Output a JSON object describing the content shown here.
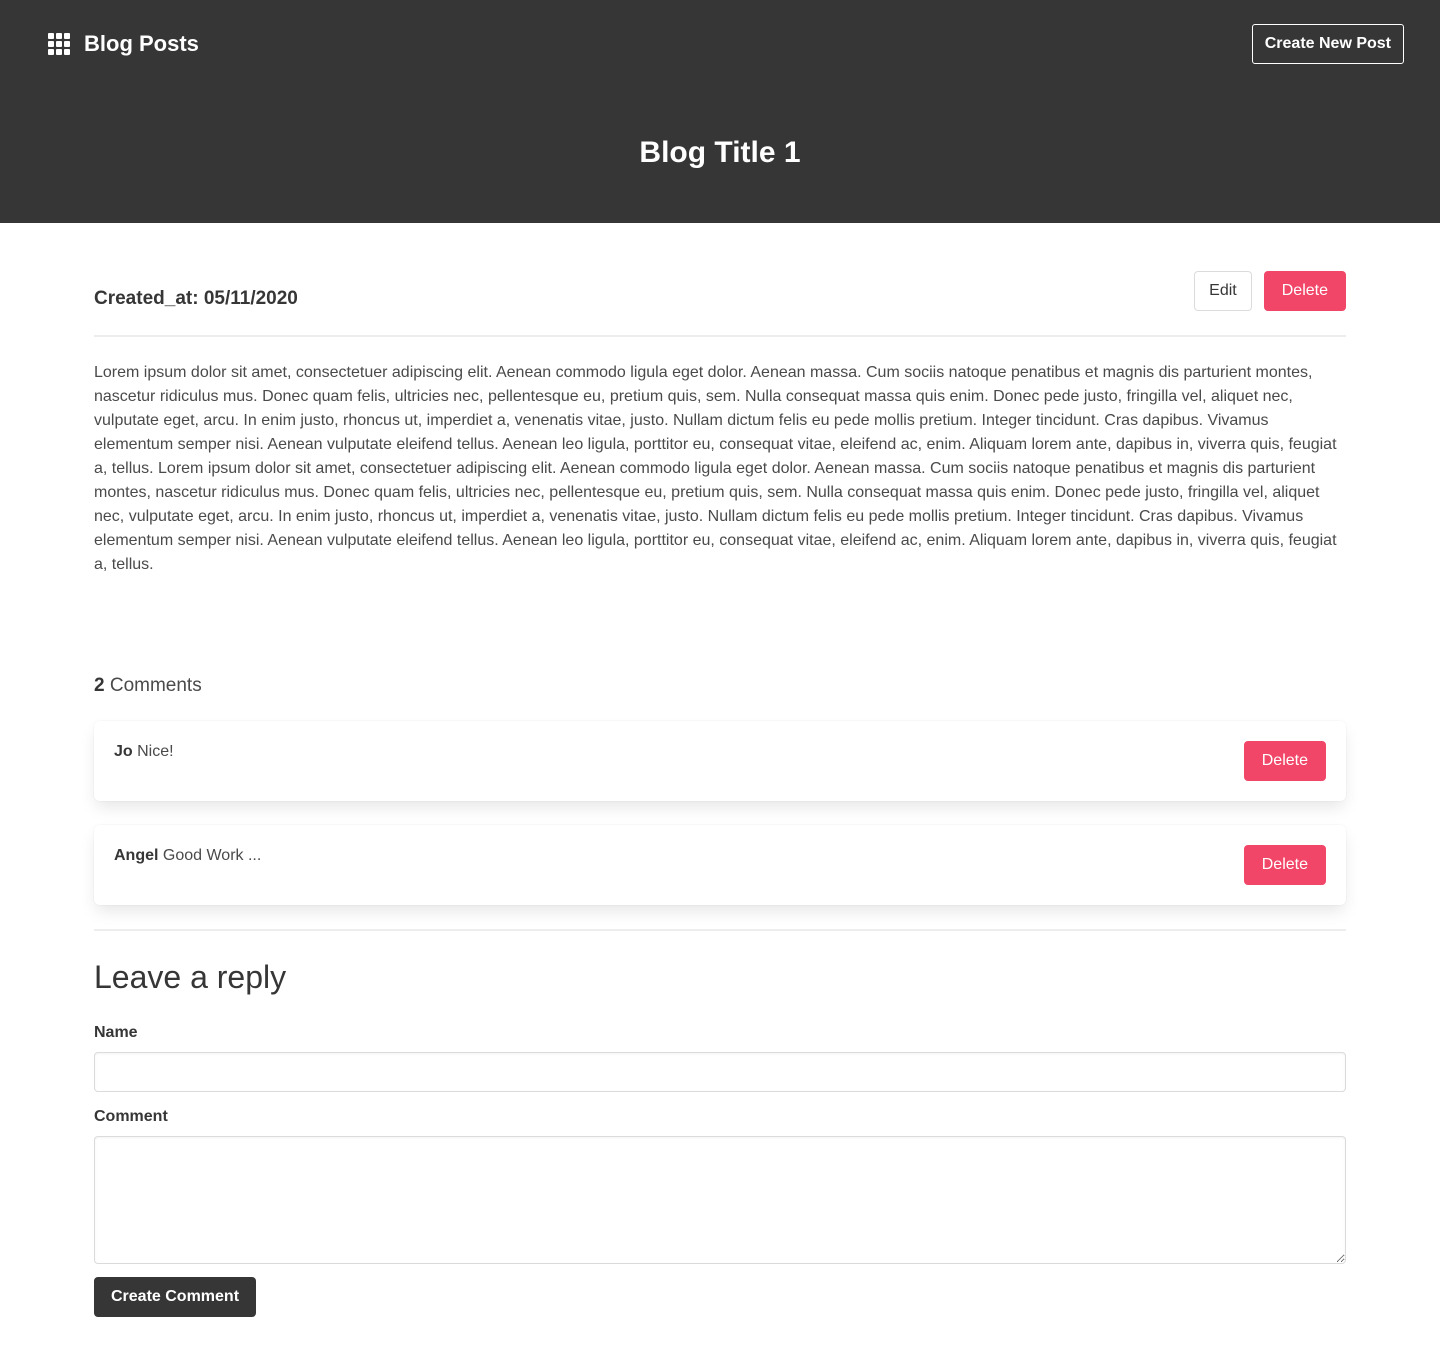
{
  "header": {
    "brand_icon": "grid-icon",
    "brand_title": "Blog Posts",
    "create_button": "Create New Post",
    "post_title": "Blog Title 1"
  },
  "post": {
    "created_at": "Created_at: 05/11/2020",
    "edit_label": "Edit",
    "delete_label": "Delete",
    "body": "Lorem ipsum dolor sit amet, consectetuer adipiscing elit. Aenean commodo ligula eget dolor. Aenean massa. Cum sociis natoque penatibus et magnis dis parturient montes, nascetur ridiculus mus. Donec quam felis, ultricies nec, pellentesque eu, pretium quis, sem. Nulla consequat massa quis enim. Donec pede justo, fringilla vel, aliquet nec, vulputate eget, arcu. In enim justo, rhoncus ut, imperdiet a, venenatis vitae, justo. Nullam dictum felis eu pede mollis pretium. Integer tincidunt. Cras dapibus. Vivamus elementum semper nisi. Aenean vulputate eleifend tellus. Aenean leo ligula, porttitor eu, consequat vitae, eleifend ac, enim. Aliquam lorem ante, dapibus in, viverra quis, feugiat a, tellus. Lorem ipsum dolor sit amet, consectetuer adipiscing elit. Aenean commodo ligula eget dolor. Aenean massa. Cum sociis natoque penatibus et magnis dis parturient montes, nascetur ridiculus mus. Donec quam felis, ultricies nec, pellentesque eu, pretium quis, sem. Nulla consequat massa quis enim. Donec pede justo, fringilla vel, aliquet nec, vulputate eget, arcu. In enim justo, rhoncus ut, imperdiet a, venenatis vitae, justo. Nullam dictum felis eu pede mollis pretium. Integer tincidunt. Cras dapibus. Vivamus elementum semper nisi. Aenean vulputate eleifend tellus. Aenean leo ligula, porttitor eu, consequat vitae, eleifend ac, enim. Aliquam lorem ante, dapibus in, viverra quis, feugiat a, tellus."
  },
  "comments": {
    "count": "2",
    "count_label": "Comments",
    "items": [
      {
        "author": "Jo",
        "text": "Nice!",
        "delete_label": "Delete"
      },
      {
        "author": "Angel",
        "text": "Good Work ...",
        "delete_label": "Delete"
      }
    ]
  },
  "reply": {
    "title": "Leave a reply",
    "name_label": "Name",
    "name_value": "",
    "comment_label": "Comment",
    "comment_value": "",
    "submit_label": "Create Comment"
  },
  "colors": {
    "hero_bg": "#363636",
    "danger": "#f14668",
    "dark": "#363636"
  }
}
